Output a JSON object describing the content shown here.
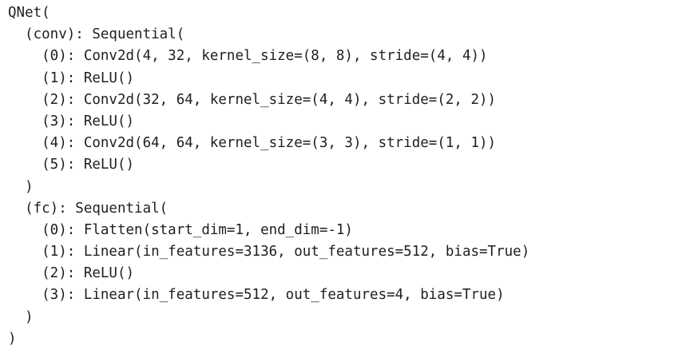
{
  "output": {
    "lines": [
      "QNet(",
      "  (conv): Sequential(",
      "    (0): Conv2d(4, 32, kernel_size=(8, 8), stride=(4, 4))",
      "    (1): ReLU()",
      "    (2): Conv2d(32, 64, kernel_size=(4, 4), stride=(2, 2))",
      "    (3): ReLU()",
      "    (4): Conv2d(64, 64, kernel_size=(3, 3), stride=(1, 1))",
      "    (5): ReLU()",
      "  )",
      "  (fc): Sequential(",
      "    (0): Flatten(start_dim=1, end_dim=-1)",
      "    (1): Linear(in_features=3136, out_features=512, bias=True)",
      "    (2): ReLU()",
      "    (3): Linear(in_features=512, out_features=4, bias=True)",
      "  )",
      ")"
    ]
  }
}
